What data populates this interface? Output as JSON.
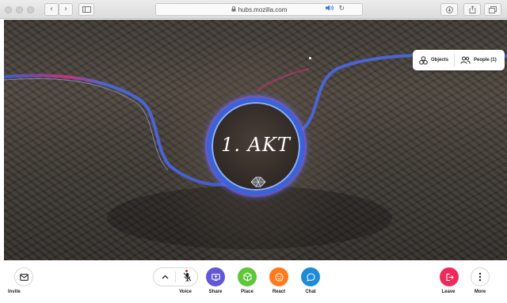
{
  "browser": {
    "url": "hubs.mozilla.com",
    "nav_back": "‹",
    "nav_forward": "›",
    "lock_glyph": "🔒",
    "audio_glyph": "◀)",
    "reload_glyph": "↻"
  },
  "scene": {
    "portal_label": "1. AKT"
  },
  "top_panel": {
    "objects_label": "Objects",
    "people_label": "People (1)"
  },
  "toolbar": {
    "invite_label": "Invite",
    "voice_label": "Voice",
    "share_label": "Share",
    "place_label": "Place",
    "react_label": "React",
    "chat_label": "Chat",
    "leave_label": "Leave",
    "more_label": "More"
  },
  "colors": {
    "share": "#6257d6",
    "place": "#5ec63a",
    "react": "#ff7a1c",
    "chat": "#1f8bd6",
    "leave": "#f1295b",
    "portal_ring": "#3c63d6"
  }
}
